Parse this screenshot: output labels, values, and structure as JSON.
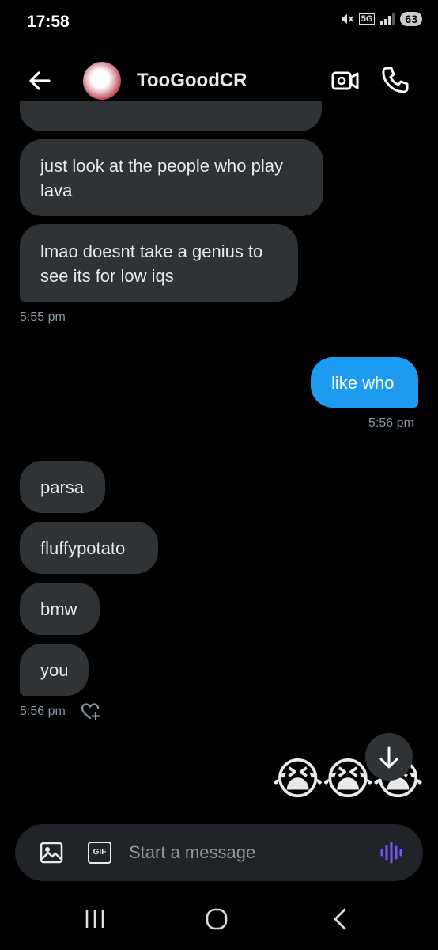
{
  "status_bar": {
    "time": "17:58",
    "network": "5G",
    "battery": "63"
  },
  "header": {
    "contact_name": "TooGoodCR"
  },
  "messages": [
    {
      "direction": "in",
      "text": "just look at the people who play lava"
    },
    {
      "direction": "in",
      "text": "lmao doesnt take a genius to see its for low iqs"
    },
    {
      "timestamp": "5:55 pm"
    },
    {
      "direction": "out",
      "text": "like who"
    },
    {
      "timestamp": "5:56 pm"
    },
    {
      "direction": "in",
      "text": "parsa"
    },
    {
      "direction": "in",
      "text": "fluffypotato"
    },
    {
      "direction": "in",
      "text": "bmw"
    },
    {
      "direction": "in",
      "text": "you"
    },
    {
      "timestamp": "5:56 pm"
    },
    {
      "direction": "out",
      "text": "😭😭😭"
    }
  ],
  "composer": {
    "placeholder": "Start a message",
    "gif_label": "GIF"
  },
  "icons": [
    "back-arrow-icon",
    "video-call-icon",
    "phone-icon",
    "heart-plus-icon",
    "arrow-down-icon",
    "image-icon",
    "gif-icon",
    "voice-icon",
    "recents-icon",
    "home-icon",
    "back-icon"
  ],
  "colors": {
    "background": "#000000",
    "incoming_bubble": "#2f3336",
    "outgoing_bubble": "#1d9bf0",
    "voice_accent": "#7856ff"
  }
}
